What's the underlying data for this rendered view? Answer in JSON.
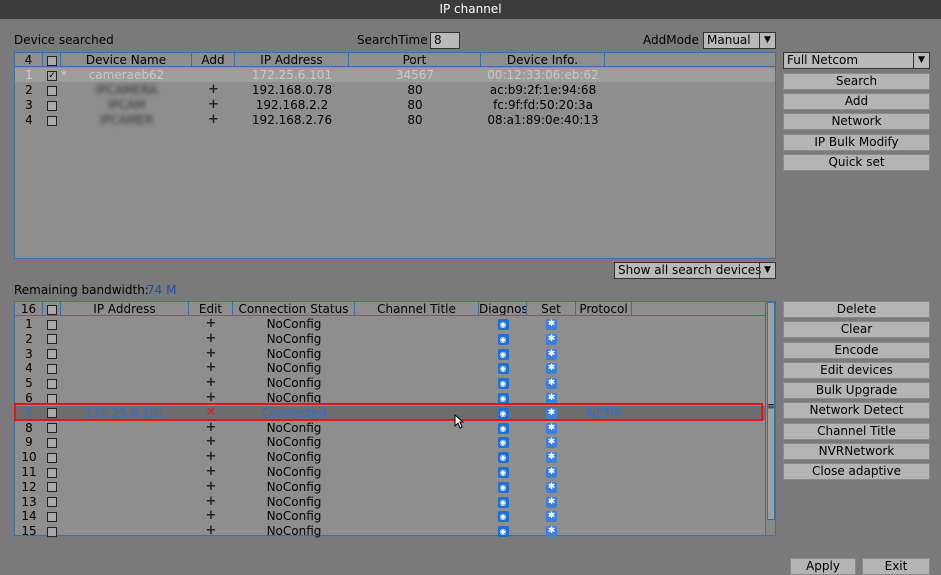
{
  "window": {
    "title": "IP channel"
  },
  "search": {
    "label": "Device searched",
    "search_time_label": "SearchTime",
    "search_time_value": "8",
    "add_mode_label": "AddMode",
    "add_mode_value": "Manual",
    "protocol_value": "Full Netcom",
    "count": "4",
    "columns": [
      "Device Name",
      "Add",
      "IP Address",
      "Port",
      "Device Info."
    ],
    "rows": [
      {
        "num": "1",
        "checked": "✓",
        "star": "*",
        "name": "cameraeb62",
        "ip": "172.25.6.101",
        "port": "34567",
        "info": "00:12:33:06:eb:62",
        "dim": true
      },
      {
        "num": "2",
        "checked": "",
        "star": "",
        "name": "IPCAMERA",
        "ip": "192.168.0.78",
        "port": "80",
        "info": "ac:b9:2f:1e:94:68",
        "dim": false
      },
      {
        "num": "3",
        "checked": "",
        "star": "",
        "name": "IPCAM",
        "ip": "192.168.2.2",
        "port": "80",
        "info": "fc:9f:fd:50:20:3a",
        "dim": false
      },
      {
        "num": "4",
        "checked": "",
        "star": "",
        "name": "IPCAMER",
        "ip": "192.168.2.76",
        "port": "80",
        "info": "08:a1:89:0e:40:13",
        "dim": false
      }
    ],
    "show_filter": "Show all search devices"
  },
  "right_buttons_top": [
    "Search",
    "Add",
    "Network",
    "IP Bulk Modify",
    "Quick set"
  ],
  "bandwidth": {
    "label": "Remaining bandwidth:",
    "value": "74 M"
  },
  "channels": {
    "count": "16",
    "columns": [
      "IP Address",
      "Edit",
      "Connection Status",
      "Channel Title",
      "Diagnosis",
      "Set",
      "Protocol"
    ],
    "rows": [
      {
        "num": "1",
        "ip": "",
        "edit": "+",
        "status": "NoConfig",
        "protocol": ""
      },
      {
        "num": "2",
        "ip": "",
        "edit": "+",
        "status": "NoConfig",
        "protocol": ""
      },
      {
        "num": "3",
        "ip": "",
        "edit": "+",
        "status": "NoConfig",
        "protocol": ""
      },
      {
        "num": "4",
        "ip": "",
        "edit": "+",
        "status": "NoConfig",
        "protocol": ""
      },
      {
        "num": "5",
        "ip": "",
        "edit": "+",
        "status": "NoConfig",
        "protocol": ""
      },
      {
        "num": "6",
        "ip": "",
        "edit": "+",
        "status": "NoConfig",
        "protocol": ""
      },
      {
        "num": "7",
        "ip": "172.25.6.101",
        "edit": "✕",
        "status": "Connected",
        "protocol": "NETIP"
      },
      {
        "num": "8",
        "ip": "",
        "edit": "+",
        "status": "NoConfig",
        "protocol": ""
      },
      {
        "num": "9",
        "ip": "",
        "edit": "+",
        "status": "NoConfig",
        "protocol": ""
      },
      {
        "num": "10",
        "ip": "",
        "edit": "+",
        "status": "NoConfig",
        "protocol": ""
      },
      {
        "num": "11",
        "ip": "",
        "edit": "+",
        "status": "NoConfig",
        "protocol": ""
      },
      {
        "num": "12",
        "ip": "",
        "edit": "+",
        "status": "NoConfig",
        "protocol": ""
      },
      {
        "num": "13",
        "ip": "",
        "edit": "+",
        "status": "NoConfig",
        "protocol": ""
      },
      {
        "num": "14",
        "ip": "",
        "edit": "+",
        "status": "NoConfig",
        "protocol": ""
      },
      {
        "num": "15",
        "ip": "",
        "edit": "+",
        "status": "NoConfig",
        "protocol": ""
      }
    ]
  },
  "right_buttons_bottom": [
    "Delete",
    "Clear",
    "Encode",
    "Edit devices",
    "Bulk Upgrade",
    "Network Detect",
    "Channel Title",
    "NVRNetwork",
    "Close adaptive"
  ],
  "footer": {
    "apply": "Apply",
    "exit": "Exit"
  },
  "colors": {
    "highlight_row": "#6d6d6d",
    "connected_text": "#2e6fd6",
    "highlight_border": "#e0141b",
    "delete_icon": "#d42020"
  }
}
